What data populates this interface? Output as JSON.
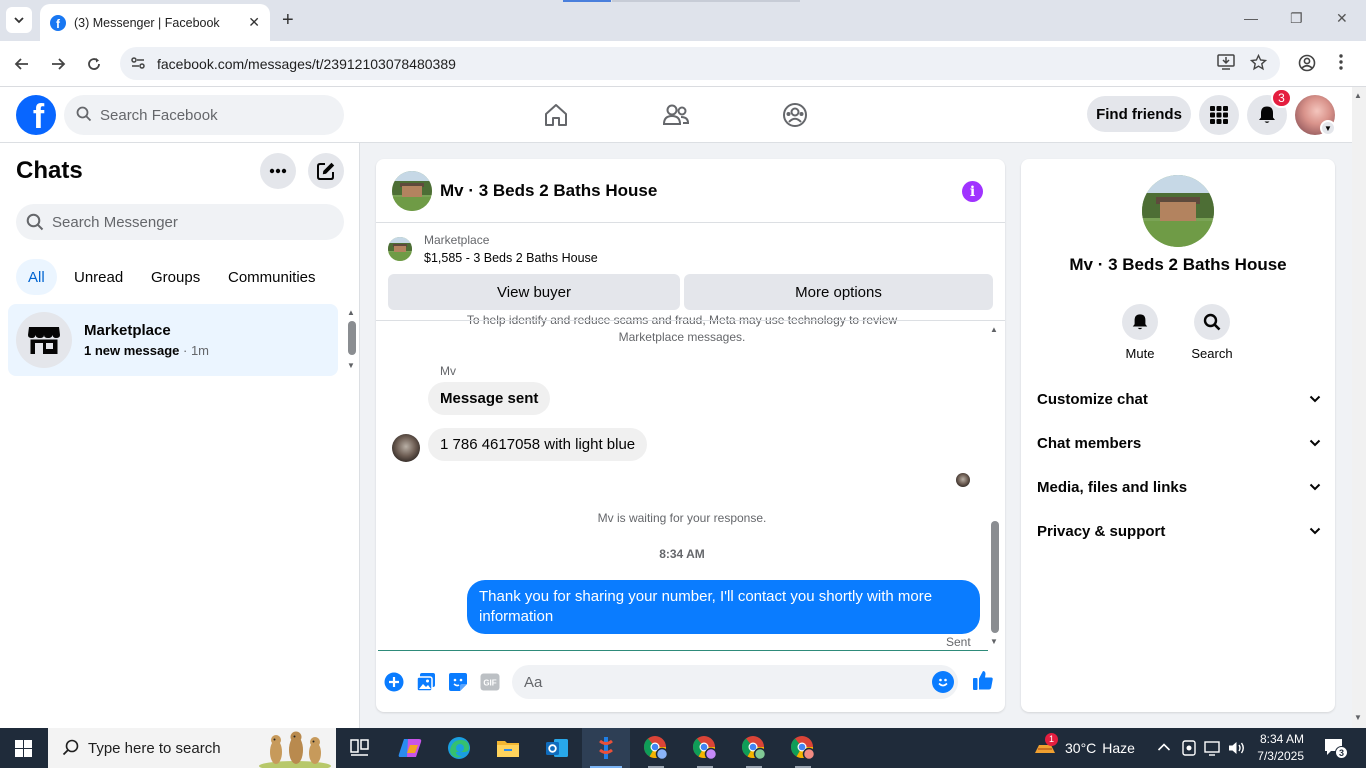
{
  "browser": {
    "tab_title": "(3) Messenger | Facebook",
    "favicon_letter": "f",
    "url": "facebook.com/messages/t/23912103078480389"
  },
  "fb_header": {
    "logo_letter": "f",
    "search_placeholder": "Search Facebook",
    "find_friends_label": "Find friends",
    "notification_count": "3"
  },
  "left_panel": {
    "title": "Chats",
    "search_placeholder": "Search Messenger",
    "filters": [
      {
        "label": "All",
        "active": true
      },
      {
        "label": "Unread",
        "active": false
      },
      {
        "label": "Groups",
        "active": false
      },
      {
        "label": "Communities",
        "active": false
      }
    ],
    "chats": [
      {
        "name": "Marketplace",
        "preview_bold": "1 new message",
        "time": " · 1m"
      }
    ]
  },
  "conversation": {
    "title": "Mv · 3 Beds 2 Baths House",
    "marketplace_label": "Marketplace",
    "listing": "$1,585 - 3 Beds 2 Baths House",
    "view_buyer_label": "View buyer",
    "more_options_label": "More options",
    "cut_notice_line1": "To help identify and reduce scams and fraud, Meta may use technology to review",
    "cut_notice_line2": "Marketplace messages.",
    "sender_name": "Mv",
    "incoming": [
      "Message sent",
      "1 786 4617058 with light blue"
    ],
    "waiting_text": "Mv is waiting for your response.",
    "time": "8:34 AM",
    "outgoing": "Thank you for sharing your number, I'll contact you shortly with more information",
    "sent_status": "Sent",
    "compose_placeholder": "Aa",
    "gif_label": "GIF"
  },
  "right_panel": {
    "name": "Mv · 3 Beds 2 Baths House",
    "actions": [
      {
        "label": "Mute",
        "icon": "bell-icon"
      },
      {
        "label": "Search",
        "icon": "search-icon"
      }
    ],
    "sections": [
      "Customize chat",
      "Chat members",
      "Media, files and links",
      "Privacy & support"
    ]
  },
  "taskbar": {
    "search_placeholder": "Type here to search",
    "weather_temp": "30°C",
    "weather_desc": "Haze",
    "weather_badge": "1",
    "time": "8:34 AM",
    "date": "7/3/2025",
    "notification_count": "3"
  },
  "colors": {
    "facebook_blue": "#0866ff",
    "outgoing_bubble": "#0a7cff",
    "info_purple": "#a033ff",
    "badge_red": "#e41e3f"
  }
}
